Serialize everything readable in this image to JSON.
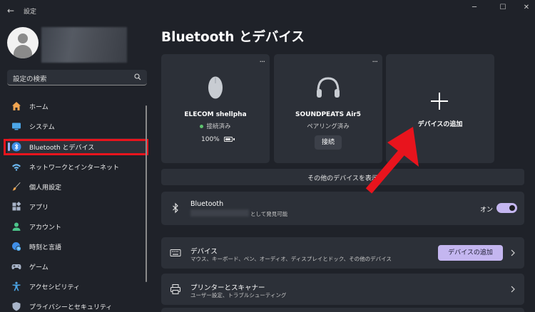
{
  "window": {
    "title": "設定",
    "back_glyph": "←",
    "minimize_glyph": "─",
    "maximize_glyph": "☐",
    "close_glyph": "✕"
  },
  "search": {
    "placeholder": "設定の検索"
  },
  "nav": [
    {
      "label": "ホーム",
      "icon": "home-icon"
    },
    {
      "label": "システム",
      "icon": "system-icon"
    },
    {
      "label": "Bluetooth とデバイス",
      "icon": "bluetooth-icon",
      "selected": true
    },
    {
      "label": "ネットワークとインターネット",
      "icon": "wifi-icon"
    },
    {
      "label": "個人用設定",
      "icon": "brush-icon"
    },
    {
      "label": "アプリ",
      "icon": "apps-icon"
    },
    {
      "label": "アカウント",
      "icon": "account-icon"
    },
    {
      "label": "時刻と言語",
      "icon": "globe-clock-icon"
    },
    {
      "label": "ゲーム",
      "icon": "gamepad-icon"
    },
    {
      "label": "アクセシビリティ",
      "icon": "accessibility-icon"
    },
    {
      "label": "プライバシーとセキュリティ",
      "icon": "shield-icon"
    }
  ],
  "page": {
    "title": "Bluetooth とデバイス"
  },
  "devices": [
    {
      "name": "ELECOM shellpha",
      "status": "接続済み",
      "battery": "100%",
      "more": "···"
    },
    {
      "name": "SOUNDPEATS Air5",
      "status": "ペアリング済み",
      "action": "接続",
      "more": "···"
    }
  ],
  "add_card": {
    "label": "デバイスの追加"
  },
  "more_devices": {
    "label": "その他のデバイスを表示"
  },
  "bluetooth_row": {
    "title": "Bluetooth",
    "subtitle_suffix": "として発見可能",
    "toggle_label": "オン",
    "toggle_on": true
  },
  "devices_row": {
    "title": "デバイス",
    "subtitle": "マウス、キーボード、ペン、オーディオ、ディスプレイとドック、その他のデバイス",
    "button": "デバイスの追加"
  },
  "printers_row": {
    "title": "プリンターとスキャナー",
    "subtitle": "ユーザー設定、トラブルシューティング"
  },
  "colors": {
    "accent": "#c4b6f0",
    "annotation_red": "#e8141d",
    "background": "#1f2229",
    "card": "#2c3038"
  }
}
